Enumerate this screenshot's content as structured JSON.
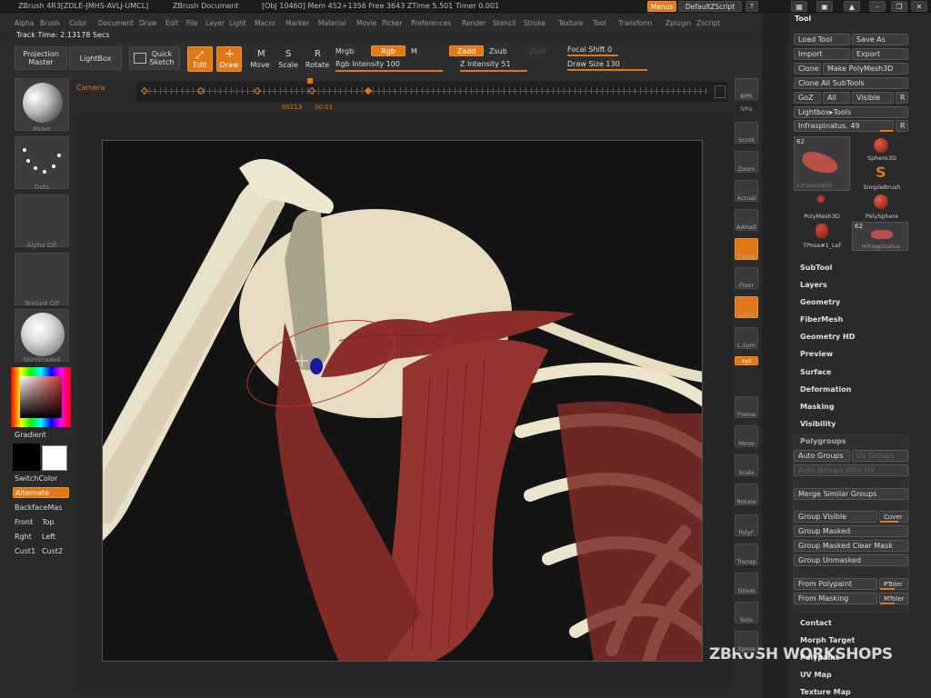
{
  "titlebar": {
    "app": "ZBrush 4R3[ZDLE-JMHS-AVLJ-UMCL]",
    "doc": "ZBrush Document",
    "stats": "[Obj 10460] Mem 452+1356 Free 3643 ZTime 5.501 Timer 0.001",
    "menus_btn": "Menus",
    "script": "DefaultZScript"
  },
  "menubar": [
    "Alpha",
    "Brush",
    "Color",
    "Document",
    "Draw",
    "Edit",
    "File",
    "Layer",
    "Light",
    "Macro",
    "Marker",
    "Material",
    "Movie",
    "Picker",
    "Preferences",
    "Render",
    "Stencil",
    "Stroke",
    "Texture",
    "Tool",
    "Transform",
    "Zplugin",
    "Zscript"
  ],
  "track_time": "Track Time: 2.13178 Secs",
  "toolbar": {
    "projection_master": "Projection Master",
    "lightbox": "LightBox",
    "quick_sketch": "Quick Sketch",
    "edit": "Edit",
    "draw": "Draw",
    "move": "Move",
    "scale": "Scale",
    "rotate": "Rotate",
    "mrgb": "Mrgb",
    "rgb": "Rgb",
    "m": "M",
    "rgb_intensity": "Rgb Intensity 100",
    "zadd": "Zadd",
    "zsub": "Zsub",
    "zcut": "Zcut",
    "z_intensity": "Z Intensity 51",
    "focal_shift": "Focal Shift 0",
    "draw_size": "Draw Size 130"
  },
  "left_shelf": {
    "brush_caption": "Move",
    "stroke_caption": "Dots",
    "alpha_caption": "Alpha Off",
    "texture_caption": "Texture Off",
    "material_caption": "SkinShade4",
    "gradient": "Gradient",
    "switchcolor": "SwitchColor",
    "alternate": "Alternate",
    "backface": "BackfaceMas",
    "front": "Front",
    "top": "Top",
    "right": "Rght",
    "left": "Left",
    "cust1": "Cust1",
    "cust2": "Cust2",
    "primary_color": "#000000",
    "secondary_color": "#ffffff"
  },
  "timeline": {
    "camera": "Camera",
    "frame_a": "00213",
    "frame_b": "00:01"
  },
  "right_shelf": [
    "BPR",
    "SPix",
    "Scroll",
    "Zoom",
    "Actual",
    "AAHalf",
    "Persp",
    "Floor",
    "Local",
    "L.Sym",
    "xyz",
    "Frame",
    "Move",
    "Scale",
    "Rotate",
    "PolyF",
    "Transp",
    "Ghost",
    "Solo",
    "Xpose"
  ],
  "tool_panel": {
    "title": "Tool",
    "load_tool": "Load Tool",
    "save_as": "Save As",
    "import": "Import",
    "export": "Export",
    "clone": "Clone",
    "make_polymesh": "Make PolyMesh3D",
    "clone_all": "Clone All SubTools",
    "goz": "GoZ",
    "all": "All",
    "visible": "Visible",
    "r": "R",
    "lightbox_tools": "Lightbox▸Tools",
    "current_tool": "Infraspinatus. 49",
    "tool_count": "62",
    "tool_count2": "62",
    "tools": [
      "Infraspinatus",
      "Sphere3D",
      "SimpleBrush",
      "PolyMesh3D",
      "PolySphere",
      "TPose#1_Lef",
      "Infraspinatus"
    ],
    "sections": [
      "SubTool",
      "Layers",
      "Geometry",
      "FiberMesh",
      "Geometry HD",
      "Preview",
      "Surface",
      "Deformation",
      "Masking",
      "Visibility",
      "Polygroups"
    ],
    "polygroups": {
      "auto_groups": "Auto Groups",
      "uv_groups": "Uv Groups",
      "auto_groups_with_uv": "Auto Groups With UV",
      "merge_similar": "Merge Similar Groups",
      "group_visible": "Group Visible",
      "coverage": "Cover",
      "group_masked": "Group Masked",
      "group_masked_clear": "Group Masked Clear Mask",
      "group_unmasked": "Group Unmasked",
      "from_polypaint": "From Polypaint",
      "ptoler": "PToler",
      "from_masking": "From Masking",
      "mtoler": "MToler"
    },
    "sections_bottom": [
      "Contact",
      "Morph Target",
      "Polypaint",
      "UV Map",
      "Texture Map"
    ]
  },
  "watermark": "ZBRUSH WORKSHOPS",
  "colors": {
    "accent": "#e07818",
    "bone": "#ebe3cc",
    "muscle": "#8c2f2a",
    "background": "#141414"
  }
}
